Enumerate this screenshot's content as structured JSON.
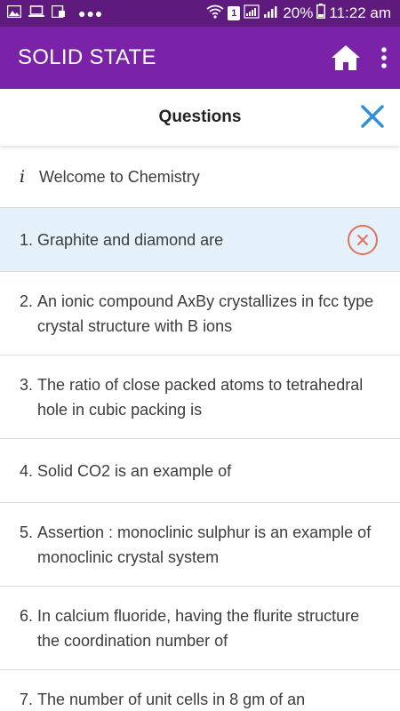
{
  "status_bar": {
    "battery": "20%",
    "time": "11:22 am",
    "sim_label": "1"
  },
  "app_bar": {
    "title": "SOLID STATE"
  },
  "panel": {
    "title": "Questions"
  },
  "intro": {
    "icon_label": "i",
    "text": "Welcome to Chemistry"
  },
  "questions": [
    {
      "num": "1. ",
      "text": "Graphite and diamond are",
      "status": "wrong"
    },
    {
      "num": "2. ",
      "text": "An ionic compound AxBy crystallizes in fcc type crystal structure with B ions"
    },
    {
      "num": "3. ",
      "text": "The ratio of close packed atoms to tetrahedral hole in cubic packing is"
    },
    {
      "num": "4. ",
      "text": "Solid CO2 is an example of"
    },
    {
      "num": "5. ",
      "text": "Assertion : monoclinic sulphur is an example of monoclinic crystal system"
    },
    {
      "num": "6. ",
      "text": "In calcium fluoride, having the flurite structure the coordination number of"
    },
    {
      "num": "7. ",
      "text": "The number of unit cells in 8 gm of an"
    }
  ],
  "colors": {
    "status_bar": "#5e1a7c",
    "app_bar": "#7a22a8",
    "close_icon": "#2f8fd8",
    "wrong_icon": "#e07060",
    "selected_row": "#e4f1fa"
  }
}
